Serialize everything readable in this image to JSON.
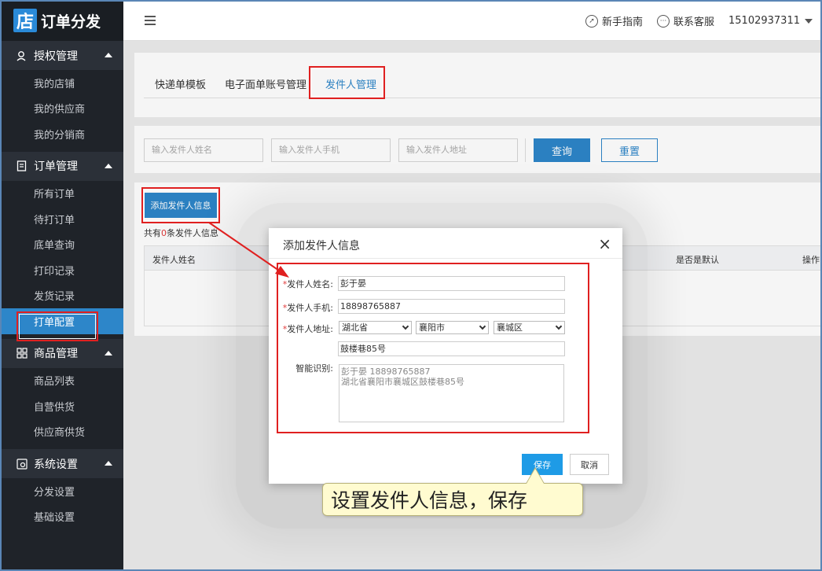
{
  "app": {
    "logo_char": "店",
    "title": "订单分发"
  },
  "sidebar": {
    "groups": [
      {
        "label": "授权管理",
        "icon": "user-key-icon",
        "items": [
          "我的店铺",
          "我的供应商",
          "我的分销商"
        ]
      },
      {
        "label": "订单管理",
        "icon": "order-list-icon",
        "items": [
          "所有订单",
          "待打订单",
          "底单查询",
          "打印记录",
          "发货记录",
          "打单配置"
        ]
      },
      {
        "label": "商品管理",
        "icon": "grid-icon",
        "items": [
          "商品列表",
          "自营供货",
          "供应商供货"
        ]
      },
      {
        "label": "系统设置",
        "icon": "settings-icon",
        "items": [
          "分发设置",
          "基础设置"
        ]
      }
    ],
    "active_item": "打单配置"
  },
  "topbar": {
    "guide": "新手指南",
    "service": "联系客服",
    "account": "15102937311"
  },
  "tabs": [
    "快递单模板",
    "电子面单账号管理",
    "发件人管理"
  ],
  "active_tab": "发件人管理",
  "search": {
    "name_placeholder": "输入发件人姓名",
    "phone_placeholder": "输入发件人手机",
    "address_placeholder": "输入发件人地址",
    "query_label": "查询",
    "reset_label": "重置"
  },
  "list": {
    "add_label": "添加发件人信息",
    "count_prefix": "共有",
    "count": "0",
    "count_suffix": "条发件人信息",
    "headers": [
      "发件人姓名",
      "是否是默认",
      "操作"
    ]
  },
  "modal": {
    "title": "添加发件人信息",
    "close": "×",
    "name_label": "发件人姓名:",
    "name_value": "彭于晏",
    "phone_label": "发件人手机:",
    "phone_value": "18898765887",
    "address_label": "发件人地址:",
    "province": "湖北省",
    "city": "襄阳市",
    "district": "襄城区",
    "street": "鼓楼巷85号",
    "smart_label": "智能识别:",
    "smart_text": "彭于晏 18898765887\n湖北省襄阳市襄城区鼓楼巷85号",
    "save_label": "保存",
    "cancel_label": "取消"
  },
  "callout": {
    "text": "设置发件人信息，保存"
  },
  "colors": {
    "accent": "#2d86c9",
    "highlight": "#e02020",
    "sidebar": "#1f2329"
  }
}
